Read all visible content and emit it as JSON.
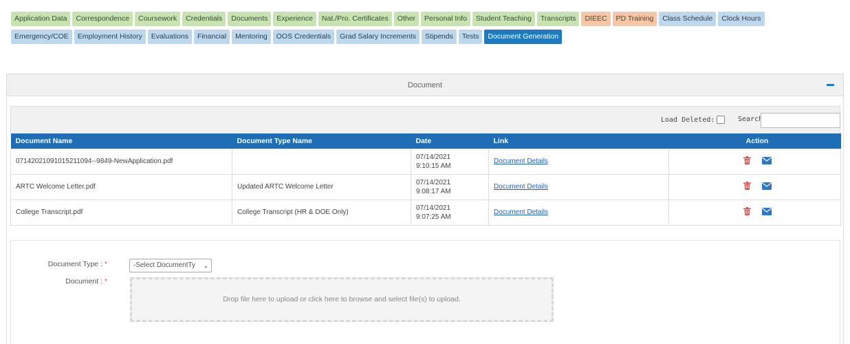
{
  "tabs_row1": [
    {
      "label": "Application Data",
      "style": "green"
    },
    {
      "label": "Correspondence",
      "style": "green"
    },
    {
      "label": "Coursework",
      "style": "green"
    },
    {
      "label": "Credentials",
      "style": "green"
    },
    {
      "label": "Documents",
      "style": "green"
    },
    {
      "label": "Experience",
      "style": "green"
    },
    {
      "label": "Nat./Pro. Certificates",
      "style": "green"
    },
    {
      "label": "Other",
      "style": "green"
    },
    {
      "label": "Personal Info",
      "style": "green"
    },
    {
      "label": "Student Teaching",
      "style": "green"
    },
    {
      "label": "Transcripts",
      "style": "green"
    },
    {
      "label": "DIEEC",
      "style": "orange"
    },
    {
      "label": "PD Training",
      "style": "orange"
    },
    {
      "label": "Class Schedule",
      "style": "blue"
    },
    {
      "label": "Clock Hours",
      "style": "blue"
    }
  ],
  "tabs_row2": [
    {
      "label": "Emergency/COE",
      "style": "blue"
    },
    {
      "label": "Employment History",
      "style": "blue"
    },
    {
      "label": "Evaluations",
      "style": "blue"
    },
    {
      "label": "Financial",
      "style": "blue"
    },
    {
      "label": "Mentoring",
      "style": "blue"
    },
    {
      "label": "OOS Credentials",
      "style": "blue"
    },
    {
      "label": "Grad Salary Increments",
      "style": "blue"
    },
    {
      "label": "Stipends",
      "style": "blue"
    },
    {
      "label": "Tests",
      "style": "blue"
    },
    {
      "label": "Document Generation",
      "style": "active"
    }
  ],
  "panel": {
    "title": "Document"
  },
  "toolbar": {
    "load_deleted_label": "Load Deleted:",
    "search_label": "Search:",
    "search_value": ""
  },
  "table": {
    "headers": {
      "name": "Document Name",
      "type": "Document Type Name",
      "date": "Date",
      "link": "Link",
      "action": "Action"
    },
    "rows": [
      {
        "name": "07142021091015211094--9849-NewApplication.pdf",
        "type": "",
        "date": "07/14/2021",
        "time": "9:10:15 AM",
        "link": "Document Details"
      },
      {
        "name": "ARTC Welcome Letter.pdf",
        "type": "Updated ARTC Welcome Letter",
        "date": "07/14/2021",
        "time": "9:08:17 AM",
        "link": "Document Details"
      },
      {
        "name": "College Transcript.pdf",
        "type": "College Transcript (HR & DOE Only)",
        "date": "07/14/2021",
        "time": "9:07:25 AM",
        "link": "Document Details"
      }
    ]
  },
  "form": {
    "doc_type_label": "Document Type :",
    "doc_type_selected": "-Select DocumentTy",
    "document_label": "Document :",
    "dropzone_text": "Drop file here to upload or click here to browse and select file(s) to upload."
  },
  "colors": {
    "header_blue": "#1f6eb5",
    "active_tab": "#1f7bbf",
    "delete_red": "#d9534f",
    "mail_blue": "#2f78c4"
  },
  "icons": {
    "delete": "trash-icon",
    "email": "envelope-icon",
    "collapse": "minus-icon",
    "dropdown": "chevron-down-icon"
  }
}
